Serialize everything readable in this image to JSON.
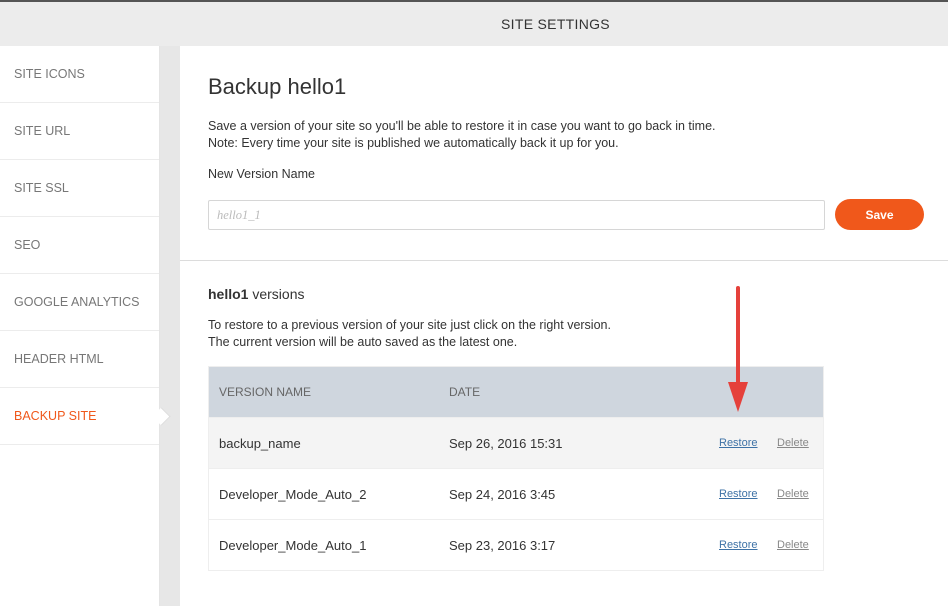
{
  "header": {
    "title": "SITE SETTINGS"
  },
  "sidebar": {
    "items": [
      {
        "label": "SITE ICONS"
      },
      {
        "label": "SITE URL"
      },
      {
        "label": "SITE SSL"
      },
      {
        "label": "SEO"
      },
      {
        "label": "GOOGLE ANALYTICS"
      },
      {
        "label": "HEADER HTML"
      },
      {
        "label": "BACKUP SITE",
        "active": true
      }
    ]
  },
  "main": {
    "title": "Backup hello1",
    "description_line1": "Save a version of your site so you'll be able to restore it in case you want to go back in time.",
    "description_line2": "Note: Every time your site is published we automatically back it up for you.",
    "new_version_label": "New Version Name",
    "new_version_placeholder": "hello1_1",
    "save_label": "Save",
    "versions_title_bold": "hello1",
    "versions_title_rest": " versions",
    "versions_desc_line1": "To restore to a previous version of your site just click on the right version.",
    "versions_desc_line2": "The current version will be auto saved as the latest one.",
    "table": {
      "headers": {
        "name": "VERSION NAME",
        "date": "DATE"
      },
      "rows": [
        {
          "name": "backup_name",
          "date": "Sep 26, 2016 15:31",
          "restore": "Restore",
          "delete": "Delete"
        },
        {
          "name": "Developer_Mode_Auto_2",
          "date": "Sep 24, 2016 3:45",
          "restore": "Restore",
          "delete": "Delete"
        },
        {
          "name": "Developer_Mode_Auto_1",
          "date": "Sep 23, 2016 3:17",
          "restore": "Restore",
          "delete": "Delete"
        }
      ]
    }
  },
  "colors": {
    "accent": "#f0581b",
    "link": "#3e72a6",
    "table_header": "#cfd6de",
    "annotation_arrow": "#e5413b"
  }
}
